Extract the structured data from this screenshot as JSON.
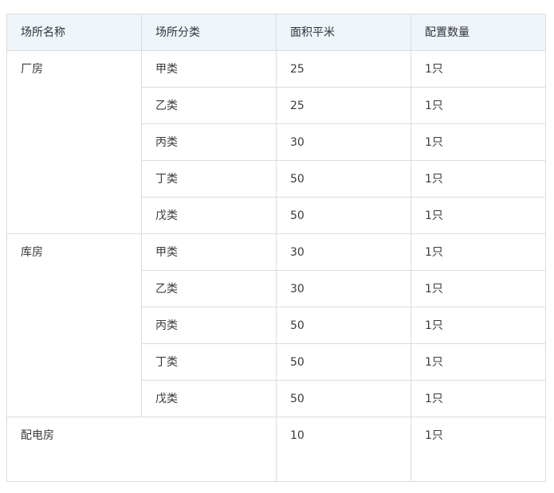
{
  "table": {
    "headers": [
      "场所名称",
      "场所分类",
      "面积平米",
      "配置数量"
    ],
    "groups": [
      {
        "name": "厂房",
        "rows": [
          {
            "category": "甲类",
            "area": "25",
            "qty": "1只"
          },
          {
            "category": "乙类",
            "area": "25",
            "qty": "1只"
          },
          {
            "category": "丙类",
            "area": "30",
            "qty": "1只"
          },
          {
            "category": "丁类",
            "area": "50",
            "qty": "1只"
          },
          {
            "category": "戊类",
            "area": "50",
            "qty": "1只"
          }
        ]
      },
      {
        "name": "库房",
        "rows": [
          {
            "category": "甲类",
            "area": "30",
            "qty": "1只"
          },
          {
            "category": "乙类",
            "area": "30",
            "qty": "1只"
          },
          {
            "category": "丙类",
            "area": "50",
            "qty": "1只"
          },
          {
            "category": "丁类",
            "area": "50",
            "qty": "1只"
          },
          {
            "category": "戊类",
            "area": "50",
            "qty": "1只"
          }
        ]
      }
    ],
    "footer_row": {
      "name": "配电房",
      "area": "10",
      "qty": "1只"
    }
  },
  "colors": {
    "header_bg": "#eef5fb",
    "border": "#dcdcdc",
    "text": "#3a3a3a"
  }
}
